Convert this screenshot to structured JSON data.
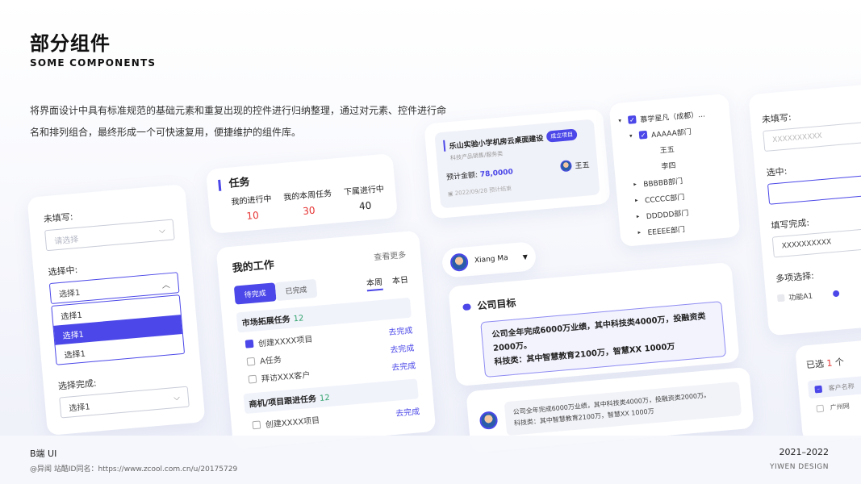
{
  "header": {
    "title": "部分组件",
    "subtitle": "SOME COMPONENTS",
    "description": "将界面设计中具有标准规范的基础元素和重复出现的控件进行归纳整理，通过对元素、控件进行命名和排列组合，最终形成一个可快速复用，便捷维护的组件库。"
  },
  "select_card": {
    "unfilled_label": "未填写:",
    "unfilled_placeholder": "请选择",
    "selecting_label": "选择中:",
    "selecting_value": "选择1",
    "options": [
      "选择1",
      "选择1",
      "选择1"
    ],
    "done_label": "选择完成:",
    "done_value": "选择1"
  },
  "task_card": {
    "title": "任务",
    "columns": [
      {
        "label": "我的进行中",
        "value": "10",
        "color": "#e63333"
      },
      {
        "label": "我的本周任务",
        "value": "30",
        "color": "#e63333"
      },
      {
        "label": "下属进行中",
        "value": "40",
        "color": "#222222"
      }
    ]
  },
  "work_card": {
    "title": "我的工作",
    "more": "查看更多",
    "segments": [
      "待完成",
      "已完成"
    ],
    "tabs": [
      "本周",
      "本日"
    ],
    "groups": [
      {
        "name": "市场拓展任务",
        "count": "12",
        "rows": [
          {
            "text": "创建XXXX项目",
            "checked": true,
            "action": "去完成"
          },
          {
            "text": "A任务",
            "checked": false,
            "action": "去完成"
          },
          {
            "text": "拜访XXX客户",
            "checked": false,
            "action": "去完成"
          }
        ]
      },
      {
        "name": "商机/项目跟进任务",
        "count": "12",
        "rows": [
          {
            "text": "创建XXXX项目",
            "checked": false,
            "action": "去完成"
          }
        ]
      }
    ]
  },
  "project_card": {
    "title": "乐山实验小学机房云桌面建设",
    "badge": "成立项目",
    "sub": "科技产品销售/服务类",
    "amount_label": "预计金额:",
    "amount": "78,0000",
    "owner": "王五",
    "date": "2022/09/28",
    "date_label": "预计结束"
  },
  "tree_card": {
    "rows": [
      {
        "text": "慕学星凡（成都）...",
        "arrow": "▾",
        "checkbox": true,
        "indent": 0
      },
      {
        "text": "AAAAA部门",
        "arrow": "▾",
        "checkbox": true,
        "indent": 1
      },
      {
        "text": "王五",
        "arrow": "",
        "checkbox": false,
        "indent": 3
      },
      {
        "text": "李四",
        "arrow": "",
        "checkbox": false,
        "indent": 3
      },
      {
        "text": "BBBBB部门",
        "arrow": "▸",
        "checkbox": false,
        "indent": 1
      },
      {
        "text": "CCCCC部门",
        "arrow": "▸",
        "checkbox": false,
        "indent": 1
      },
      {
        "text": "DDDDD部门",
        "arrow": "▸",
        "checkbox": false,
        "indent": 1
      },
      {
        "text": "EEEEE部门",
        "arrow": "▸",
        "checkbox": false,
        "indent": 1
      }
    ]
  },
  "user_chip": {
    "name": "Xiang Ma"
  },
  "goal_card": {
    "title": "公司目标",
    "line1": "公司全年完成6000万业绩，其中科技类4000万，投融资类2000万。",
    "line2": "科技类：其中智慧教育2100万，智慧XX 1000万"
  },
  "comment_card": {
    "line1": "公司全年完成6000万业绩，其中科技类4000万，投融资类2000万。",
    "line2": "科技类：其中智慧教育2100万，智慧XX 1000万"
  },
  "form_card": {
    "unfilled_label": "未填写:",
    "unfilled_placeholder": "XXXXXXXXXX",
    "selected_label": "选中:",
    "filled_label": "填写完成:",
    "filled_value": "XXXXXXXXXX",
    "multi_label": "多项选择:",
    "option": "功能A1"
  },
  "selected_card": {
    "label_prefix": "已选",
    "count": "1",
    "label_suffix": "个",
    "column": "客户名称",
    "row": "广州网"
  },
  "footer": {
    "left_title": "B端 UI",
    "left_sub": "@异闻    站酷ID同名：https://www.zcool.com.cn/u/20175729",
    "right_title": "2021–2022",
    "right_sub": "YIWEN DESIGN"
  }
}
